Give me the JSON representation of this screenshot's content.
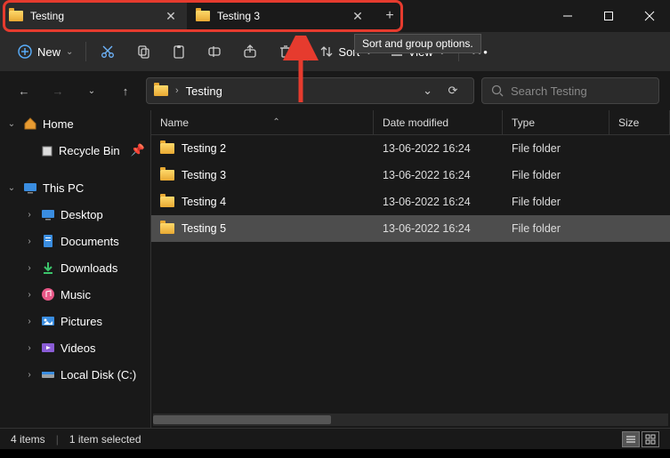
{
  "tabs": [
    {
      "label": "Testing",
      "active": true
    },
    {
      "label": "Testing 3",
      "active": false
    }
  ],
  "tooltip": "Sort and group options.",
  "toolbar": {
    "new": "New",
    "sort": "Sort",
    "view": "View"
  },
  "breadcrumb": {
    "current": "Testing"
  },
  "search": {
    "placeholder": "Search Testing"
  },
  "sidebar": {
    "home": "Home",
    "recycle": "Recycle Bin",
    "thispc": "This PC",
    "items": [
      "Desktop",
      "Documents",
      "Downloads",
      "Music",
      "Pictures",
      "Videos",
      "Local Disk (C:)"
    ]
  },
  "columns": {
    "name": "Name",
    "date": "Date modified",
    "type": "Type",
    "size": "Size"
  },
  "rows": [
    {
      "name": "Testing 2",
      "date": "13-06-2022 16:24",
      "type": "File folder",
      "sel": false
    },
    {
      "name": "Testing 3",
      "date": "13-06-2022 16:24",
      "type": "File folder",
      "sel": false
    },
    {
      "name": "Testing 4",
      "date": "13-06-2022 16:24",
      "type": "File folder",
      "sel": false
    },
    {
      "name": "Testing 5",
      "date": "13-06-2022 16:24",
      "type": "File folder",
      "sel": true
    }
  ],
  "status": {
    "count": "4 items",
    "selected": "1 item selected"
  }
}
